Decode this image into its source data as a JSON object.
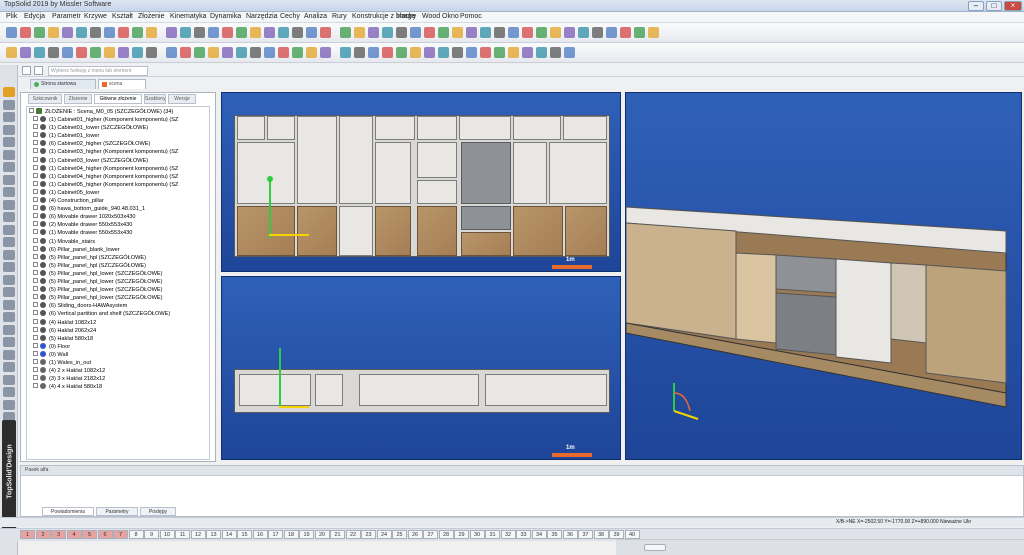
{
  "app_title": "TopSolid 2019 by Missler Software",
  "menu": [
    "Plik",
    "Edycja",
    "Parametr",
    "Krzywe",
    "Kształt",
    "Złożenie",
    "Kinematyka",
    "Dynamika",
    "Narzędzia",
    "Cechy",
    "Analiza",
    "Rury",
    "Konstrukcje z blachy",
    "Image",
    "Wood",
    "Okno",
    "Pomoc"
  ],
  "cmd_placeholder": "Wybierz funkcję z menu lub element",
  "doc_tab": "Strona startowa",
  "doc_tab2": "scena",
  "panel_tabs": [
    "Szkicownik",
    "Złożenie",
    "Główne złożenie",
    "Szablony",
    "Wersje"
  ],
  "tree_root": "ZŁOŻENIE : Scena_M0_05 (SZCZEGÓŁOWE) (34)",
  "tree_items": [
    "(1) Cabinet01_higher (Komponent komponentu) (SZ",
    "(1) Cabinet01_lower (SZCZEGÓŁOWE)",
    "(1) Cabinet01_lower",
    "(6) Cabinet02_higher (SZCZEGÓŁOWE)",
    "(1) Cabinet03_higher (Komponent komponentu) (SZ",
    "(1) Cabinet03_lower (SZCZEGÓŁOWE)",
    "(1) Cabinet04_higher (Komponent komponentu) (SZ",
    "(1) Cabinet04_higher (Komponent komponentu) (SZ",
    "(1) Cabinet05_higher (Komponent komponentu) (SZ",
    "(1) Cabinet05_lower",
    "(4) Construction_pillar",
    "(6) hawa_bottom_guide_940.48.031_1",
    "(6) Movable drawer 1020x503x430",
    "(2) Movable drawer 550x553x430",
    "(1) Movable drawer 550x553x430",
    "(1) Movable_stairs",
    "(6) Pillar_panel_blank_lower",
    "(5) Pillar_panel_hpl (SZCZEGÓŁOWE)",
    "(5) Pillar_panel_hpl (SZCZEGÓŁOWE)",
    "(5) Pillar_panel_hpl_lower (SZCZEGÓŁOWE)",
    "(5) Pillar_panel_hpl_lower (SZCZEGÓŁOWE)",
    "(5) Pillar_panel_hpl_lower (SZCZEGÓŁOWE)",
    "(5) Pillar_panel_hpl_lower (SZCZEGÓŁOWE)",
    "(6) Sliding_doors-HAWAsystem",
    "(6) Vertical partition and shelf (SZCZEGÓŁOWE)",
    "(4) Haklat 1082x12",
    "(6) Haklat 2062x24",
    "(5) Haklat 580x18",
    "(0) Floor",
    "(0) Wall",
    "(1) Wales_in_out",
    "(4) 2 x Haklat 1082x12",
    "(3) 3 x Haklat 2182x12",
    "(4) 4 x Haklat 580x18"
  ],
  "scale_label": "1m",
  "bottom_panel_title": "Pasek alfa",
  "bottom_tabs": [
    "Powiadomienia",
    "Parametry",
    "Postępy"
  ],
  "status_coords": "X/B->NE  X=-2502.50  Y=-1770.00  Z=+890.000  Nieważne  Ukr",
  "pages": [
    "1",
    "2",
    "3",
    "4",
    "5",
    "6",
    "7",
    "8",
    "9",
    "10",
    "11",
    "12",
    "13",
    "14",
    "15",
    "16",
    "17",
    "18",
    "19",
    "20",
    "21",
    "22",
    "23",
    "24",
    "25",
    "26",
    "27",
    "28",
    "29",
    "30",
    "31",
    "32",
    "33",
    "34",
    "35",
    "36",
    "37",
    "38",
    "39",
    "40"
  ],
  "brand": "TopSolid'Design",
  "colors": {
    "viewport": "#2a55a8",
    "accent": "#e86a2c"
  }
}
